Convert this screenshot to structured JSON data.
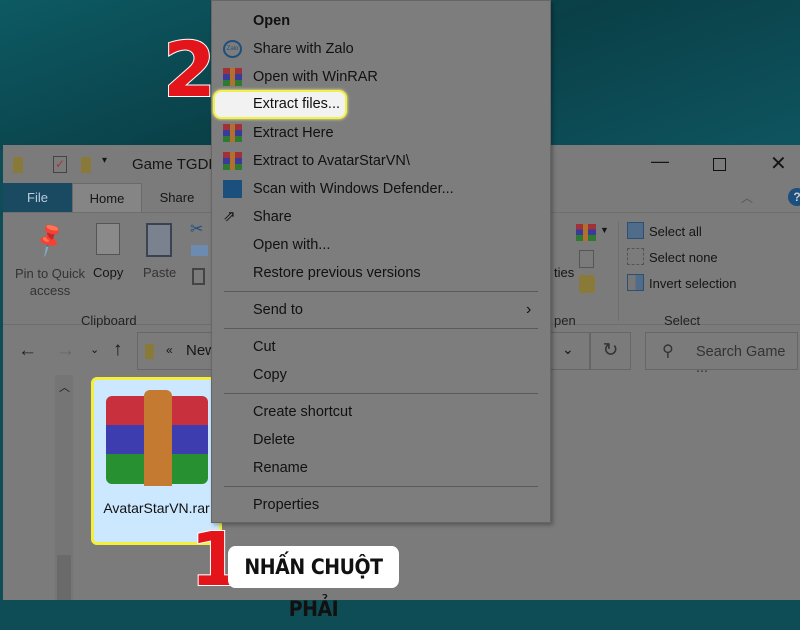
{
  "window": {
    "title": "Game TGDE",
    "tabs": [
      "File",
      "Home",
      "Share"
    ],
    "file_tab_color": "#1a5c7f"
  },
  "ribbon": {
    "clipboard": {
      "pin": "Pin to Quick access",
      "copy": "Copy",
      "paste": "Paste",
      "group": "Clipboard"
    },
    "open": {
      "properties_partial": "ties",
      "group_partial": "pen"
    },
    "select": {
      "select_all": "Select all",
      "select_none": "Select none",
      "invert": "Invert selection",
      "group": "Select"
    }
  },
  "address": {
    "path": "New",
    "search_placeholder": "Search Game ..."
  },
  "file": {
    "name": "AvatarStarVN.rar",
    "selected_color": "#cce8ff"
  },
  "context_menu": {
    "items": [
      "Open",
      "Share with Zalo",
      "Open with WinRAR",
      "Extract files...",
      "Extract Here",
      "Extract to AvatarStarVN\\",
      "Scan with Windows Defender...",
      "Share",
      "Open with...",
      "Restore previous versions",
      "Send to",
      "Cut",
      "Copy",
      "Create shortcut",
      "Delete",
      "Rename",
      "Properties"
    ],
    "zalo_text": "Zalo"
  },
  "annotations": {
    "step1": "1",
    "step1_label": "NHẤN CHUỘT PHẢI",
    "step2": "2",
    "highlight_color": "#f4ef3c",
    "number_color": "#e3151a"
  }
}
